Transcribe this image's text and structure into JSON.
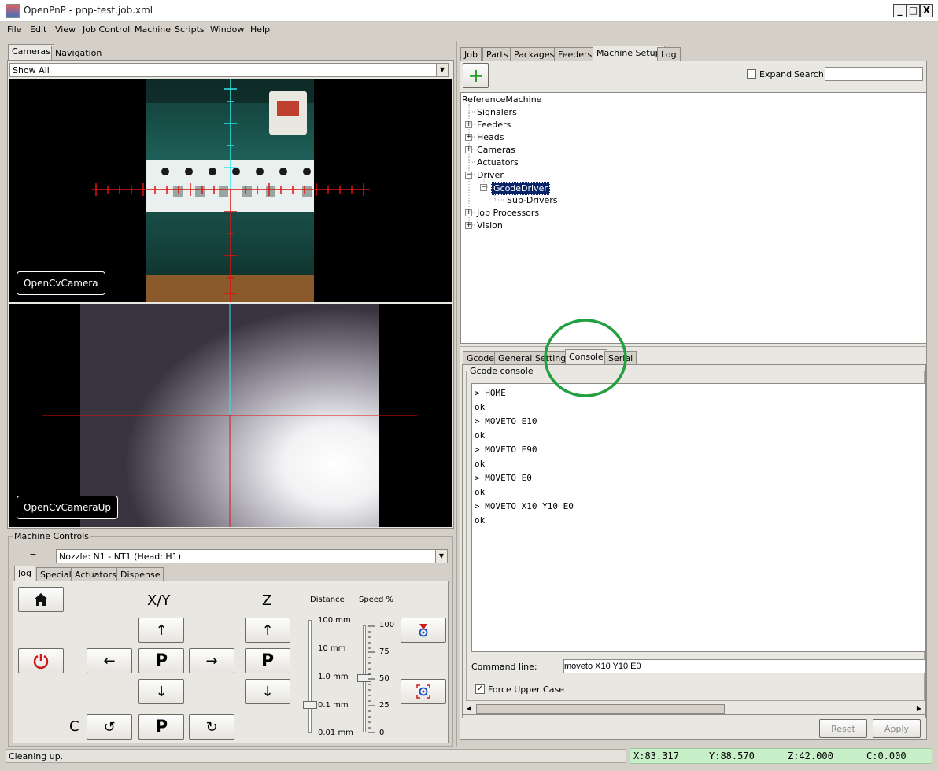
{
  "window": {
    "title": "OpenPnP - pnp-test.job.xml",
    "minimize": "_",
    "maximize": "□",
    "close": "X"
  },
  "menu": [
    "File",
    "Edit",
    "View",
    "Job Control",
    "Machine",
    "Scripts",
    "Window",
    "Help"
  ],
  "left_tabs": [
    "Cameras",
    "Navigation"
  ],
  "camera_select": "Show All",
  "cameras": {
    "top_label": "OpenCvCamera",
    "bottom_label": "OpenCvCameraUp"
  },
  "machine_controls": {
    "title": "Machine Controls",
    "collapse": "−",
    "nozzle": "Nozzle: N1 - NT1 (Head: H1)",
    "tabs": [
      "Jog",
      "Special",
      "Actuators",
      "Dispense"
    ],
    "xy_label": "X/Y",
    "z_label": "Z",
    "c_label": "C",
    "p_label": "P",
    "distance_label": "Distance",
    "speed_label": "Speed %",
    "distance_ticks": [
      "100 mm",
      "10 mm",
      "1.0 mm",
      "0.1 mm",
      "0.01 mm"
    ],
    "speed_ticks": [
      "100",
      "75",
      "50",
      "25",
      "0"
    ],
    "distance_value": "0.1 mm",
    "speed_value": 50
  },
  "right_tabs": [
    "Job",
    "Parts",
    "Packages",
    "Feeders",
    "Machine Setup",
    "Log"
  ],
  "toolbar": {
    "add": "+",
    "expand_label": "Expand",
    "search_label": "Search",
    "search_value": ""
  },
  "tree": {
    "root": "ReferenceMachine",
    "nodes": [
      "Signalers",
      "Feeders",
      "Heads",
      "Cameras",
      "Actuators",
      "Driver",
      "GcodeDriver",
      "Sub-Drivers",
      "Job Processors",
      "Vision"
    ]
  },
  "driver_tabs": [
    "Gcode",
    "General Settings",
    "Console",
    "Serial"
  ],
  "console": {
    "title": "Gcode console",
    "lines": [
      "> HOME",
      "ok",
      "> MOVETO E10",
      "ok",
      "> MOVETO E90",
      "ok",
      "> MOVETO E0",
      "ok",
      "> MOVETO X10 Y10 E0",
      "ok"
    ],
    "command_label": "Command line:",
    "command_value": "moveto X10 Y10 E0",
    "force_upper_label": "Force Upper Case"
  },
  "buttons": {
    "reset": "Reset",
    "apply": "Apply"
  },
  "status": {
    "message": "Cleaning up.",
    "x": "X:83.317",
    "y": "Y:88.570",
    "z": "Z:42.000",
    "c": "C:0.000"
  },
  "colors": {
    "highlight_circle": "#22a040",
    "selected_node_bg": "#0a246a",
    "power_red": "#cc1a1a",
    "crosshair_red": "#e01010",
    "crosshair_cyan": "#30e8e8",
    "coords_bg": "#c8f0c8"
  }
}
